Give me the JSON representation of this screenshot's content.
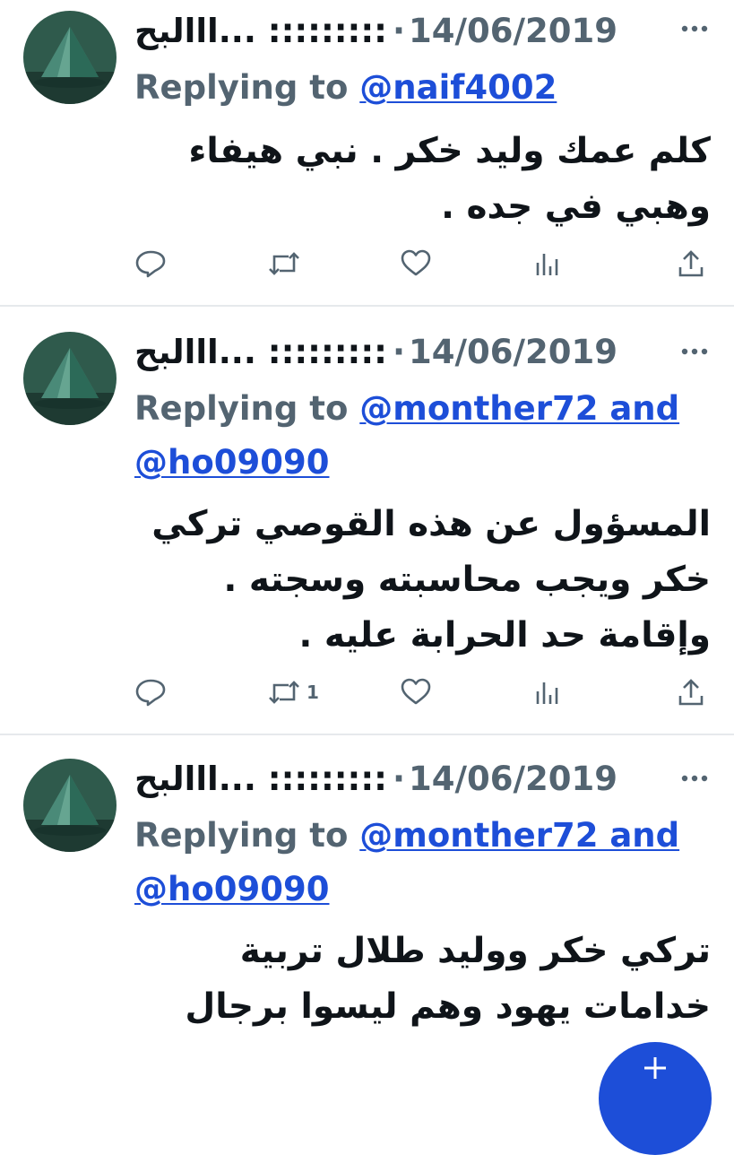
{
  "tweets": [
    {
      "display_name": "ااالبح... :::::::::",
      "separator": "·",
      "date": "14/06/2019",
      "replying_prefix": "Replying to",
      "mentions": "@naif4002",
      "mentions_cont": "",
      "text": "كلم عمك وليد خكر . نبي هيفاء وهبي في جده .",
      "retweet_count": ""
    },
    {
      "display_name": "ااالبح... :::::::::",
      "separator": "·",
      "date": "14/06/2019",
      "replying_prefix": "Replying to",
      "mentions": "@monther72 and",
      "mentions_cont": "@ho09090",
      "text": "المسؤول عن هذه القوصي تركي خكر ويجب محاسبته وسجته . وإقامة حد الحرابة عليه .",
      "retweet_count": "1"
    },
    {
      "display_name": "ااالبح... :::::::::",
      "separator": "·",
      "date": "14/06/2019",
      "replying_prefix": "Replying to",
      "mentions": "@monther72 and",
      "mentions_cont": "@ho09090",
      "text": "تركي خكر ووليد طلال تربية خدامات يهود وهم ليسوا برجال",
      "retweet_count": ""
    }
  ],
  "icons": {
    "more": "more-horizontal-icon",
    "reply": "reply-bubble-icon",
    "retweet": "retweet-icon",
    "like": "heart-icon",
    "views": "views-bar-chart-icon",
    "share": "share-upload-icon",
    "compose": "compose-plus-icon"
  },
  "colors": {
    "text": "#0f1419",
    "muted": "#536471",
    "mention": "#1d4ed8",
    "divider": "#e6e9ec",
    "fab": "#1d4ed8",
    "avatar_base": "#2f5a4c"
  }
}
